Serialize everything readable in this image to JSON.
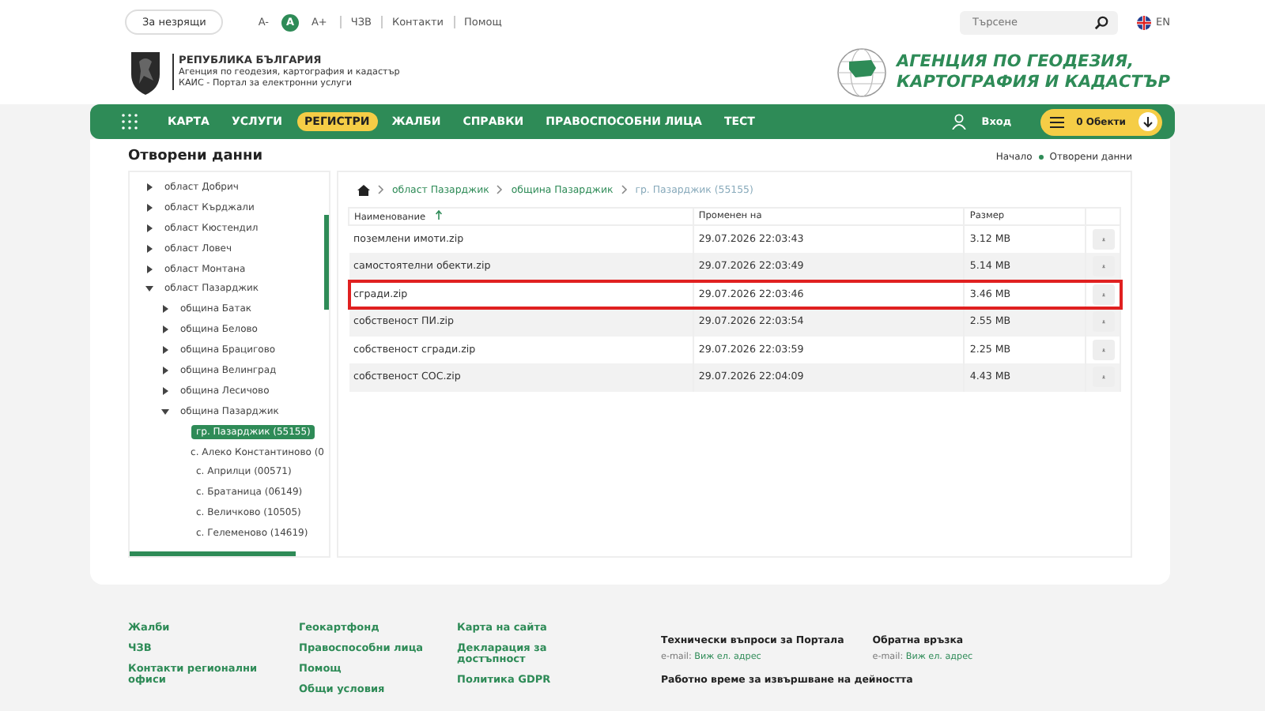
{
  "top_bar": {
    "accessibility_button": "За незрящи",
    "font_sizes": [
      {
        "label": "A-",
        "selected": false
      },
      {
        "label": "A",
        "selected": true
      },
      {
        "label": "A+",
        "selected": false
      }
    ],
    "links": [
      "ЧЗВ",
      "Контакти",
      "Помощ"
    ],
    "search": {
      "placeholder": "Търсене"
    },
    "language": "EN"
  },
  "header": {
    "title": "РЕПУБЛИКА БЪЛГАРИЯ",
    "subtitle": "Агенция по геодезия, картография и кадастър",
    "portal": "КАИС - Портал за електронни услуги",
    "agency_lines": [
      "АГЕНЦИЯ ПО ГЕОДЕЗИЯ,",
      "КАРТОГРАФИЯ И КАДАСТЪР"
    ]
  },
  "nav": {
    "items": [
      {
        "label": "КАРТА",
        "selected": false
      },
      {
        "label": "УСЛУГИ",
        "selected": false
      },
      {
        "label": "РЕГИСТРИ",
        "selected": true
      },
      {
        "label": "ЖАЛБИ",
        "selected": false
      },
      {
        "label": "СПРАВКИ",
        "selected": false
      },
      {
        "label": "ПРАВОСПОСОБНИ ЛИЦА",
        "selected": false
      },
      {
        "label": "ТЕСТ",
        "selected": false
      }
    ],
    "login": "Вход",
    "cart": "0 Обекти"
  },
  "page": {
    "title": "Отворени данни",
    "breadcrumb": [
      "Начало",
      "Отворени данни"
    ]
  },
  "tree": [
    {
      "label": "област Добрич",
      "expanded": false,
      "selected": false
    },
    {
      "label": "област Кърджали",
      "expanded": false,
      "selected": false
    },
    {
      "label": "област Кюстендил",
      "expanded": false,
      "selected": false
    },
    {
      "label": "област Ловеч",
      "expanded": false,
      "selected": false
    },
    {
      "label": "област Монтана",
      "expanded": false,
      "selected": false
    },
    {
      "label": "област Пазарджик",
      "expanded": true,
      "selected": false,
      "children": [
        {
          "label": "община Батак",
          "expanded": false,
          "selected": false
        },
        {
          "label": "община Белово",
          "expanded": false,
          "selected": false
        },
        {
          "label": "община Брацигово",
          "expanded": false,
          "selected": false
        },
        {
          "label": "община Велинград",
          "expanded": false,
          "selected": false
        },
        {
          "label": "община Лесичово",
          "expanded": false,
          "selected": false
        },
        {
          "label": "община Пазарджик",
          "expanded": true,
          "selected": false,
          "children": [
            {
              "label": "гр. Пазарджик (55155)",
              "selected": true
            },
            {
              "label": "с. Алеко Константиново (0",
              "selected": false
            },
            {
              "label": "с. Априлци (00571)",
              "selected": false
            },
            {
              "label": "с. Братаница (06149)",
              "selected": false
            },
            {
              "label": "с. Величково (10505)",
              "selected": false
            },
            {
              "label": "с. Гелеменово (14619)",
              "selected": false
            }
          ]
        }
      ]
    }
  ],
  "file_browser": {
    "path": [
      "област Пазарджик",
      "община Пазарджик",
      "гр. Пазарджик (55155)"
    ],
    "columns": [
      "Наименование",
      "Променен на",
      "Размер"
    ],
    "rows": [
      {
        "name": "поземлени имоти.zip",
        "modified": "29.07.2026 22:03:43",
        "size": "3.12 MB",
        "highlighted": false
      },
      {
        "name": "самостоятелни обекти.zip",
        "modified": "29.07.2026 22:03:49",
        "size": "5.14 MB",
        "highlighted": false
      },
      {
        "name": "сгради.zip",
        "modified": "29.07.2026 22:03:46",
        "size": "3.46 MB",
        "highlighted": true
      },
      {
        "name": "собственост ПИ.zip",
        "modified": "29.07.2026 22:03:54",
        "size": "2.55 MB",
        "highlighted": false
      },
      {
        "name": "собственост сгради.zip",
        "modified": "29.07.2026 22:03:59",
        "size": "2.25 MB",
        "highlighted": false
      },
      {
        "name": "собственост СОС.zip",
        "modified": "29.07.2026 22:04:09",
        "size": "4.43 MB",
        "highlighted": false
      }
    ]
  },
  "footer": {
    "link_columns": [
      [
        "Жалби",
        "ЧЗВ",
        "Контакти регионални офиси"
      ],
      [
        "Геокартфонд",
        "Правоспособни лица",
        "Помощ",
        "Общи условия"
      ],
      [
        "Карта на сайта",
        "Декларация за достъпност",
        "Политика GDPR"
      ]
    ],
    "contacts": [
      {
        "title": "Технически въпроси за Портала",
        "label": "e-mail:",
        "link": "Виж ел. адрес"
      },
      {
        "title": "Обратна връзка",
        "label": "e-mail:",
        "link": "Виж ел. адрес"
      }
    ],
    "hours_title": "Работно време за извършване на дейността"
  }
}
